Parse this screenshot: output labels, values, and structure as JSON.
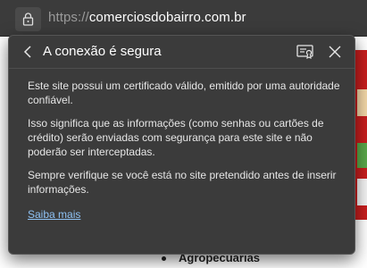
{
  "address_bar": {
    "scheme": "https://",
    "host": "comerciosdobairro.com.br"
  },
  "flyout": {
    "title": "A conexão é segura",
    "paragraphs": [
      "Este site possui um certificado válido, emitido por uma autoridade confiável.",
      "Isso significa que as informações (como senhas ou cartões de crédito) serão enviadas com segurança para este site e não poderão ser interceptadas.",
      "Sempre verifique se você está no site pretendido antes de inserir informações."
    ],
    "learn_more": "Saiba mais"
  },
  "background_page": {
    "category_item": "Agropecuarias"
  },
  "icons": {
    "lock": "lock-icon",
    "back": "chevron-left-icon",
    "certificate": "certificate-icon",
    "close": "close-icon"
  },
  "colors": {
    "chrome_bg": "#3b3b3b",
    "text_primary": "#ffffff",
    "text_body": "#e6e6e6",
    "link": "#8fc3f5",
    "url_scheme": "#9a9a9a",
    "page_accent_red": "#c81e1e"
  }
}
